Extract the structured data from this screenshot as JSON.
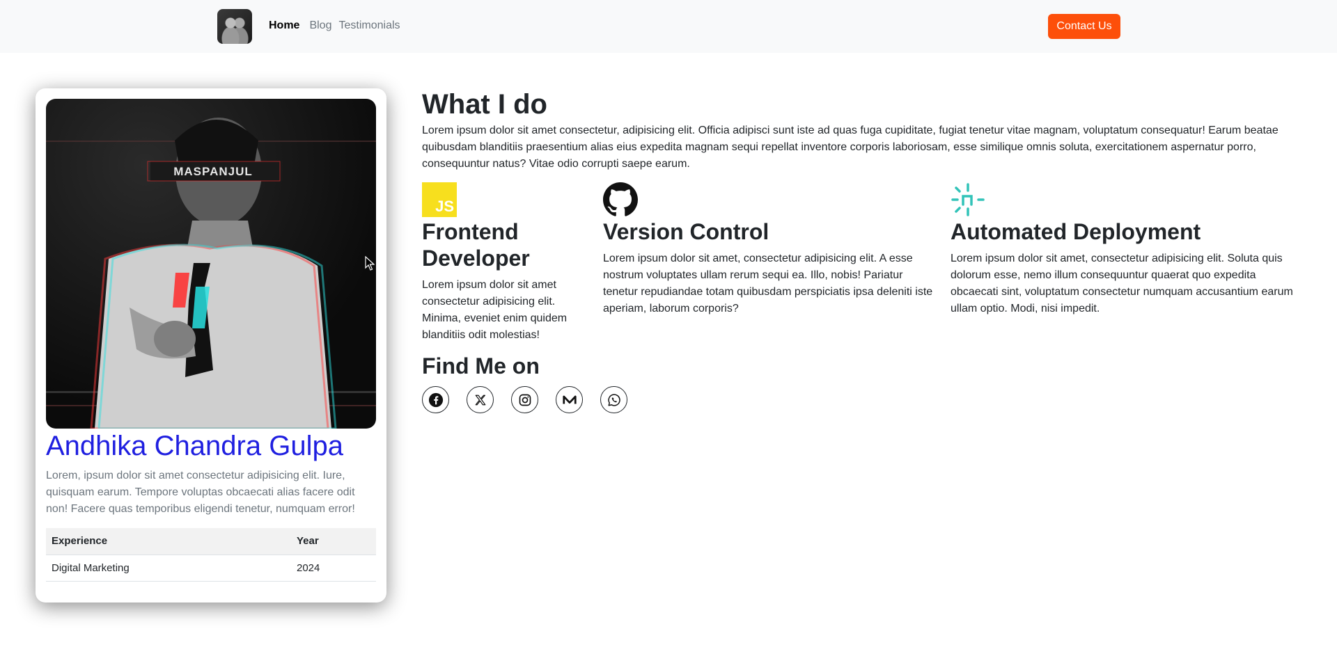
{
  "nav": {
    "links": [
      {
        "label": "Home",
        "active": true
      },
      {
        "label": "Blog",
        "active": false
      },
      {
        "label": "Testimonials",
        "active": false
      }
    ],
    "contact_label": "Contact Us",
    "accent_color": "#fd4f0a"
  },
  "profile": {
    "photo_text": "MASPANJUL",
    "name": "Andhika Chandra Gulpa",
    "name_color": "#1f1fe0",
    "bio": "Lorem, ipsum dolor sit amet consectetur adipisicing elit. Iure, quisquam earum. Tempore voluptas obcaecati alias facere odit non! Facere quas temporibus eligendi tenetur, numquam error!",
    "table": {
      "headers": [
        "Experience",
        "Year"
      ],
      "rows": [
        [
          "Digital Marketing",
          "2024"
        ]
      ]
    }
  },
  "main": {
    "title": "What I do",
    "description": "Lorem ipsum dolor sit amet consectetur, adipisicing elit. Officia adipisci sunt iste ad quas fuga cupiditate, fugiat tenetur vitae magnam, voluptatum consequatur! Earum beatae quibusdam blanditiis praesentium alias eius expedita magnam sequi repellat inventore corporis laboriosam, esse similique omnis soluta, exercitationem aspernatur porro, consequuntur natus? Vitae odio corrupti saepe earum.",
    "skills": [
      {
        "icon": "javascript-icon",
        "icon_text": "JS",
        "title": "Frontend Developer",
        "desc": "Lorem ipsum dolor sit amet consectetur adipisicing elit. Minima, eveniet enim quidem blanditiis odit molestias!"
      },
      {
        "icon": "github-icon",
        "title": "Version Control",
        "desc": "Lorem ipsum dolor sit amet, consectetur adipisicing elit. A esse nostrum voluptates ullam rerum sequi ea. Illo, nobis! Pariatur tenetur repudiandae totam quibusdam perspiciatis ipsa deleniti iste aperiam, laborum corporis?"
      },
      {
        "icon": "netlify-icon",
        "title": "Automated Deployment",
        "desc": "Lorem ipsum dolor sit amet, consectetur adipisicing elit. Soluta quis dolorum esse, nemo illum consequuntur quaerat quo expedita obcaecati sint, voluptatum consectetur numquam accusantium earum ullam optio. Modi, nisi impedit."
      }
    ],
    "find_title": "Find Me on",
    "socials": [
      "facebook-icon",
      "x-twitter-icon",
      "instagram-icon",
      "medium-icon",
      "whatsapp-icon"
    ]
  }
}
